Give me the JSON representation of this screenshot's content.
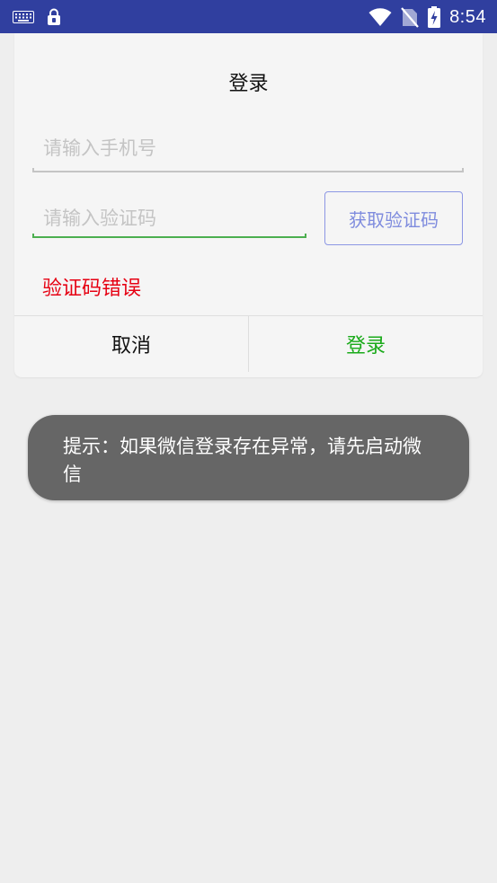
{
  "status_bar": {
    "time": "8:54",
    "icons": [
      "keyboard-icon",
      "lock-icon",
      "wifi-icon",
      "no-sim-icon",
      "battery-charging-icon"
    ],
    "background_color": "#303f9f"
  },
  "dialog": {
    "title": "登录",
    "phone_placeholder": "请输入手机号",
    "phone_value": "",
    "code_placeholder": "请输入验证码",
    "code_value": "",
    "get_code_label": "获取验证码",
    "error_message": "验证码错误",
    "cancel_label": "取消",
    "login_label": "登录",
    "colors": {
      "error": "#e60012",
      "login": "#1aaa1a",
      "get_code": "#7f8cde",
      "focus_underline": "#4caf50"
    }
  },
  "toast": {
    "message": "提示：如果微信登录存在异常，请先启动微信"
  }
}
